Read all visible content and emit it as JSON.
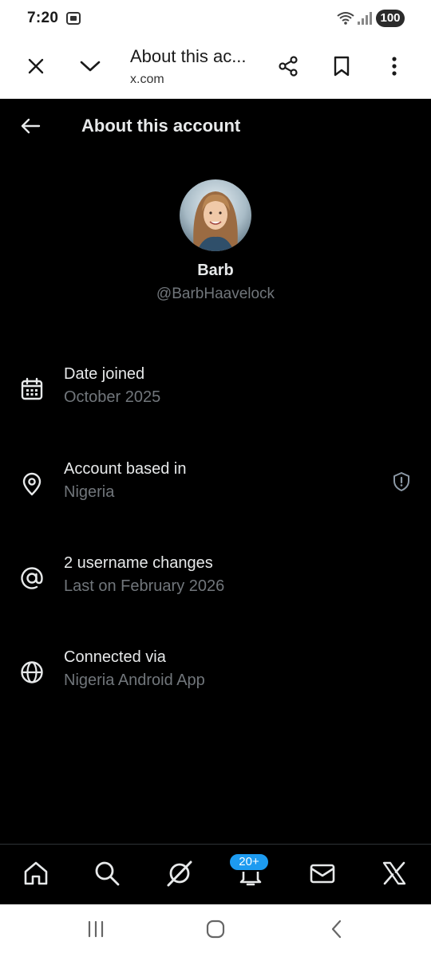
{
  "status_bar": {
    "time": "7:20",
    "battery": "100",
    "icons": [
      "screen-record-icon",
      "wifi-icon",
      "signal-icon"
    ]
  },
  "browser": {
    "page_title": "About this ac...",
    "url": "x.com",
    "icons": [
      "close-icon",
      "chevron-down-icon",
      "share-icon",
      "bookmark-icon",
      "more-vert-icon"
    ]
  },
  "header": {
    "title": "About this account"
  },
  "profile": {
    "name": "Barb",
    "handle": "@BarbHaavelock"
  },
  "info": {
    "items": [
      {
        "icon": "calendar-icon",
        "label": "Date joined",
        "value": "October 2025"
      },
      {
        "icon": "location-pin-icon",
        "label": "Account based in",
        "value": "Nigeria"
      },
      {
        "icon": "at-sign-icon",
        "label": "2 username changes",
        "value": "Last on February 2026"
      },
      {
        "icon": "globe-icon",
        "label": "Connected via",
        "value": "Nigeria Android App"
      }
    ]
  },
  "bottom_nav": {
    "notifications_badge": "20+",
    "items": [
      "home-icon",
      "search-icon",
      "grok-icon",
      "bell-icon",
      "mail-icon",
      "x-logo-icon"
    ]
  },
  "colors": {
    "background": "#000000",
    "primary_text": "#e7e9ea",
    "secondary_text": "#71767b",
    "accent": "#1d9bf0"
  }
}
